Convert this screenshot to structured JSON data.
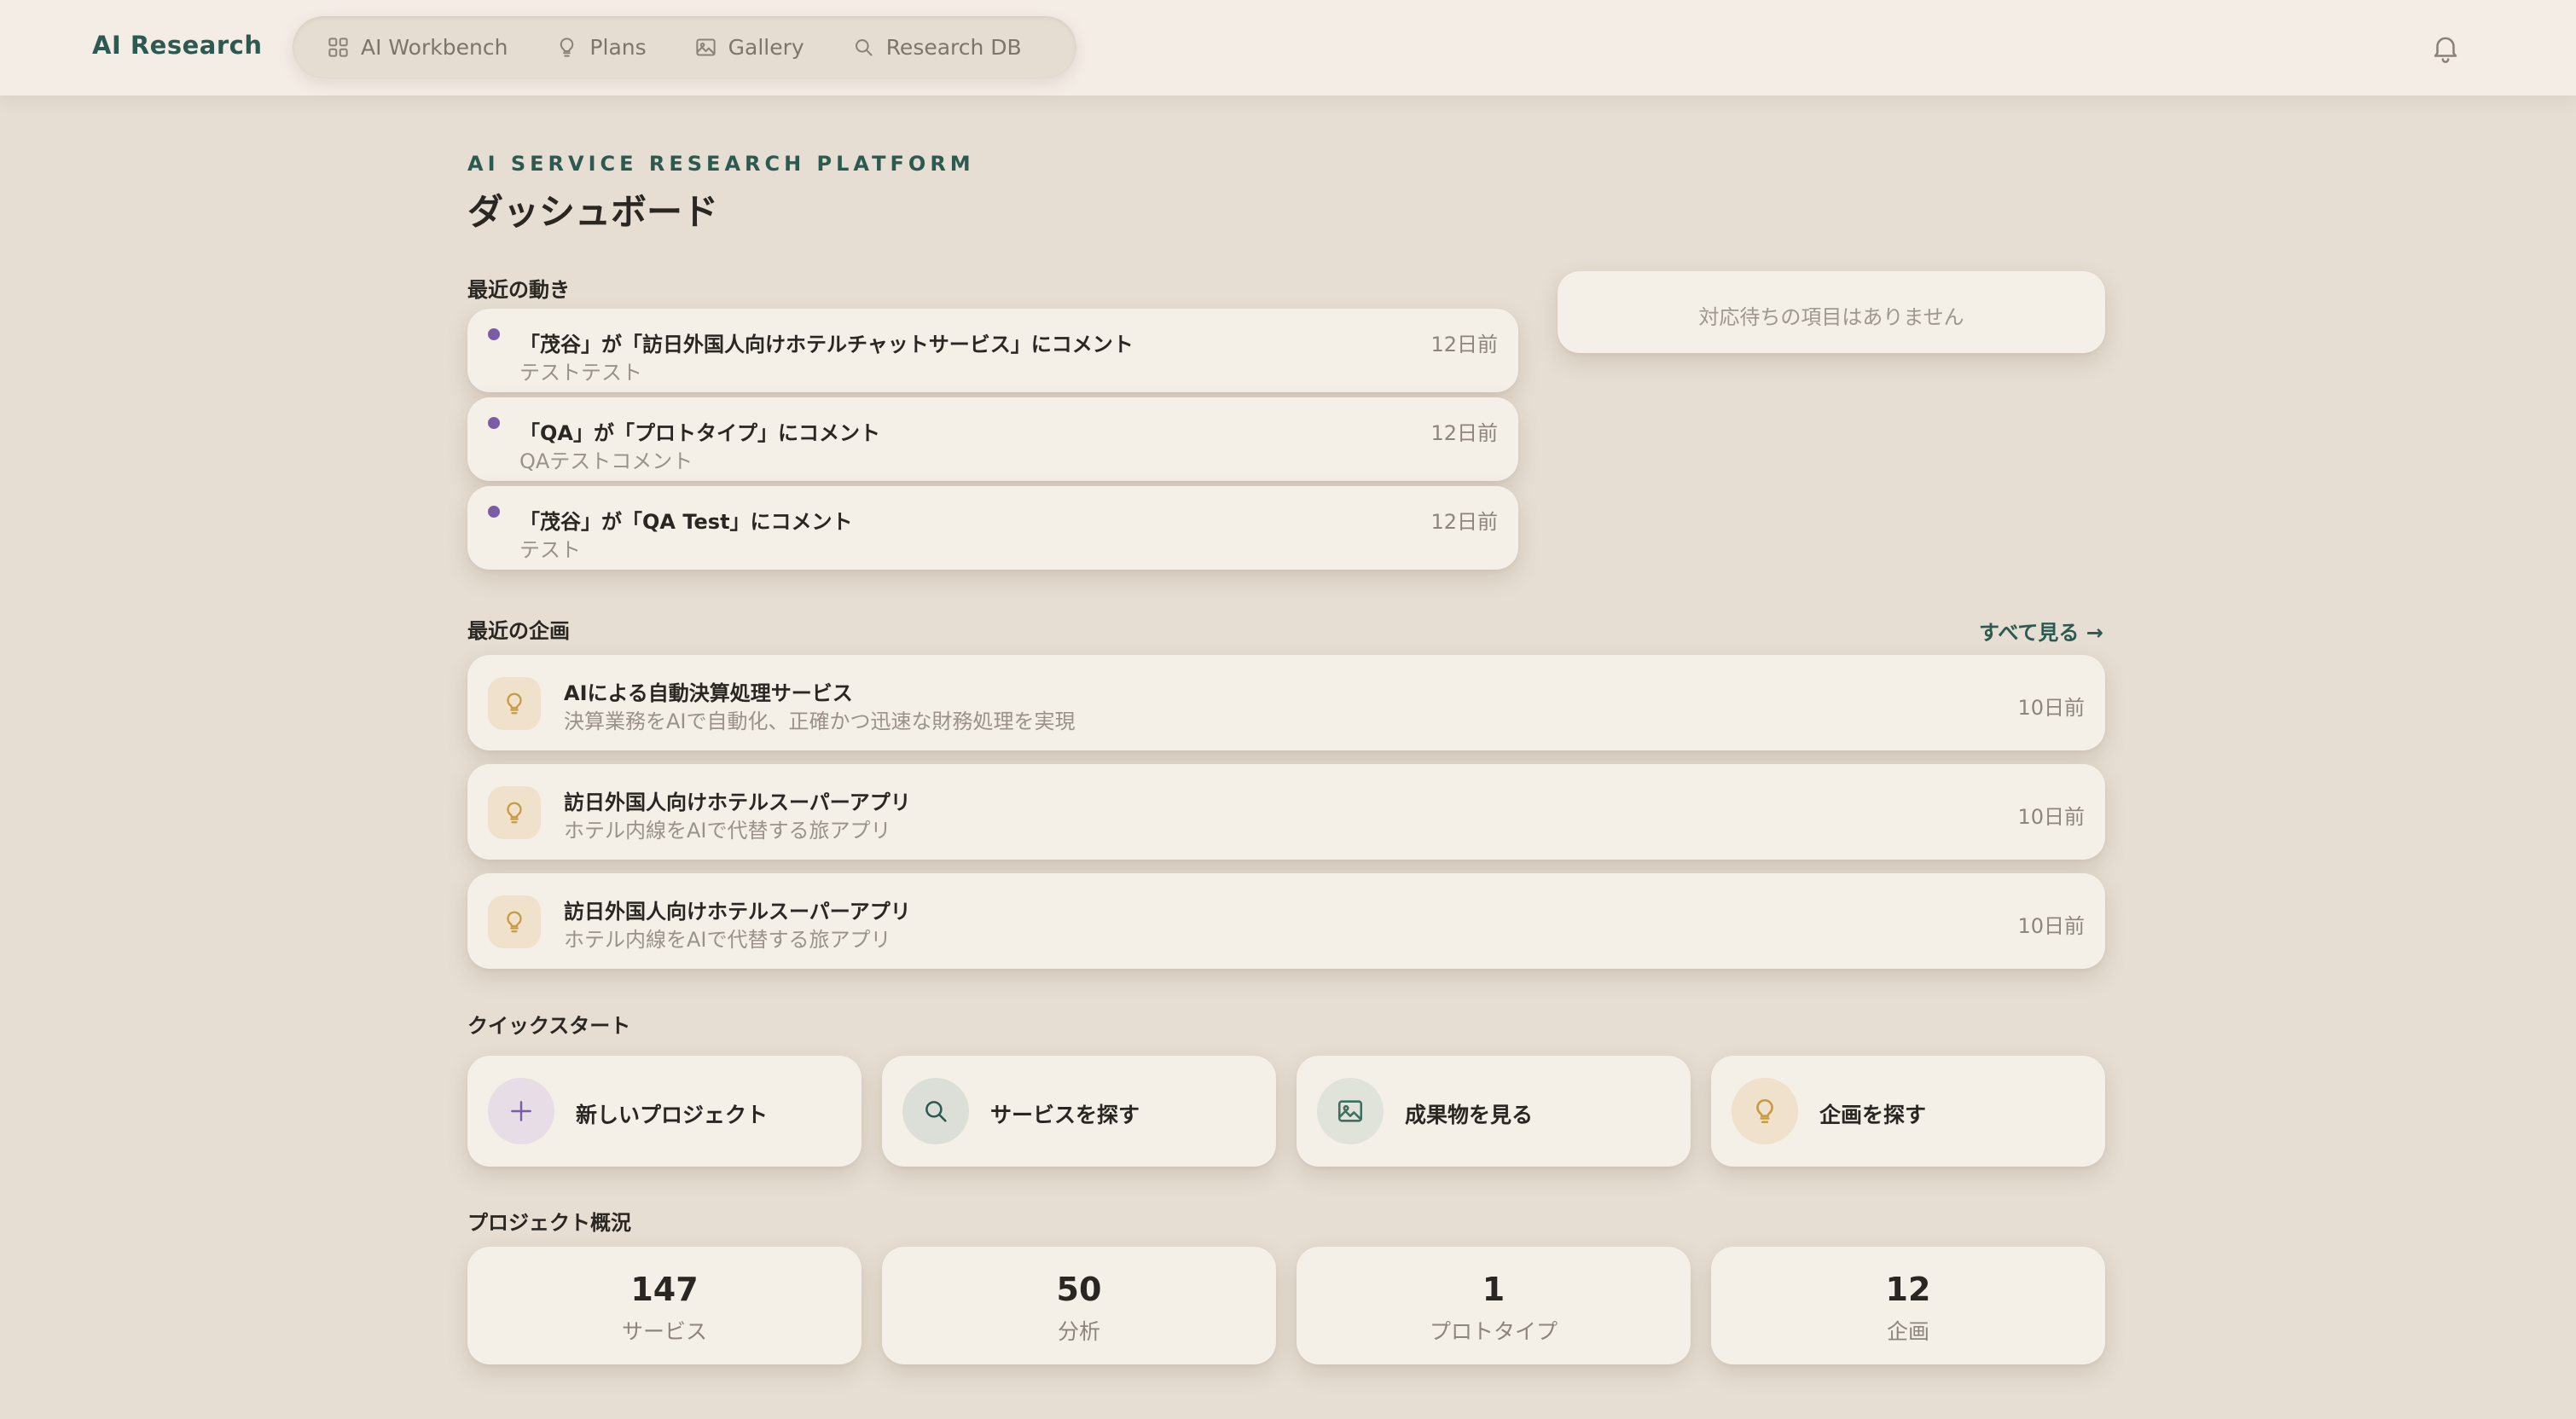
{
  "brand": "AI Research",
  "nav": [
    {
      "label": "AI Workbench",
      "icon": "grid-icon"
    },
    {
      "label": "Plans",
      "icon": "lightbulb-icon"
    },
    {
      "label": "Gallery",
      "icon": "image-icon"
    },
    {
      "label": "Research DB",
      "icon": "search-icon"
    }
  ],
  "header": {
    "eyebrow": "AI SERVICE RESEARCH PLATFORM",
    "title": "ダッシュボード"
  },
  "activity": {
    "label": "最近の動き",
    "items": [
      {
        "title": "「茂谷」が「訪日外国人向けホテルチャットサービス」にコメント",
        "subtitle": "テストテスト",
        "time": "12日前"
      },
      {
        "title": "「QA」が「プロトタイプ」にコメント",
        "subtitle": "QAテストコメント",
        "time": "12日前"
      },
      {
        "title": "「茂谷」が「QA Test」にコメント",
        "subtitle": "テスト",
        "time": "12日前"
      }
    ]
  },
  "pending": {
    "text": "対応待ちの項目はありません"
  },
  "plans": {
    "label": "最近の企画",
    "see_all": "すべて見る →",
    "items": [
      {
        "title": "AIによる自動決算処理サービス",
        "subtitle": "決算業務をAIで自動化、正確かつ迅速な財務処理を実現",
        "time": "10日前"
      },
      {
        "title": "訪日外国人向けホテルスーパーアプリ",
        "subtitle": "ホテル内線をAIで代替する旅アプリ",
        "time": "10日前"
      },
      {
        "title": "訪日外国人向けホテルスーパーアプリ",
        "subtitle": "ホテル内線をAIで代替する旅アプリ",
        "time": "10日前"
      }
    ]
  },
  "quickstart": {
    "label": "クイックスタート",
    "items": [
      {
        "label": "新しいプロジェクト",
        "icon": "plus-icon"
      },
      {
        "label": "サービスを探す",
        "icon": "search-icon"
      },
      {
        "label": "成果物を見る",
        "icon": "image-icon"
      },
      {
        "label": "企画を探す",
        "icon": "lightbulb-icon"
      }
    ]
  },
  "overview": {
    "label": "プロジェクト概況",
    "stats": [
      {
        "value": "147",
        "label": "サービス"
      },
      {
        "value": "50",
        "label": "分析"
      },
      {
        "value": "1",
        "label": "プロトタイプ"
      },
      {
        "value": "12",
        "label": "企画"
      }
    ]
  },
  "colors": {
    "background": "#e6ded2",
    "surface": "#f4efe7",
    "accent": "#2c5a50",
    "activity_dot": "#7a5ca6",
    "plan_icon": "#c99a3f"
  }
}
